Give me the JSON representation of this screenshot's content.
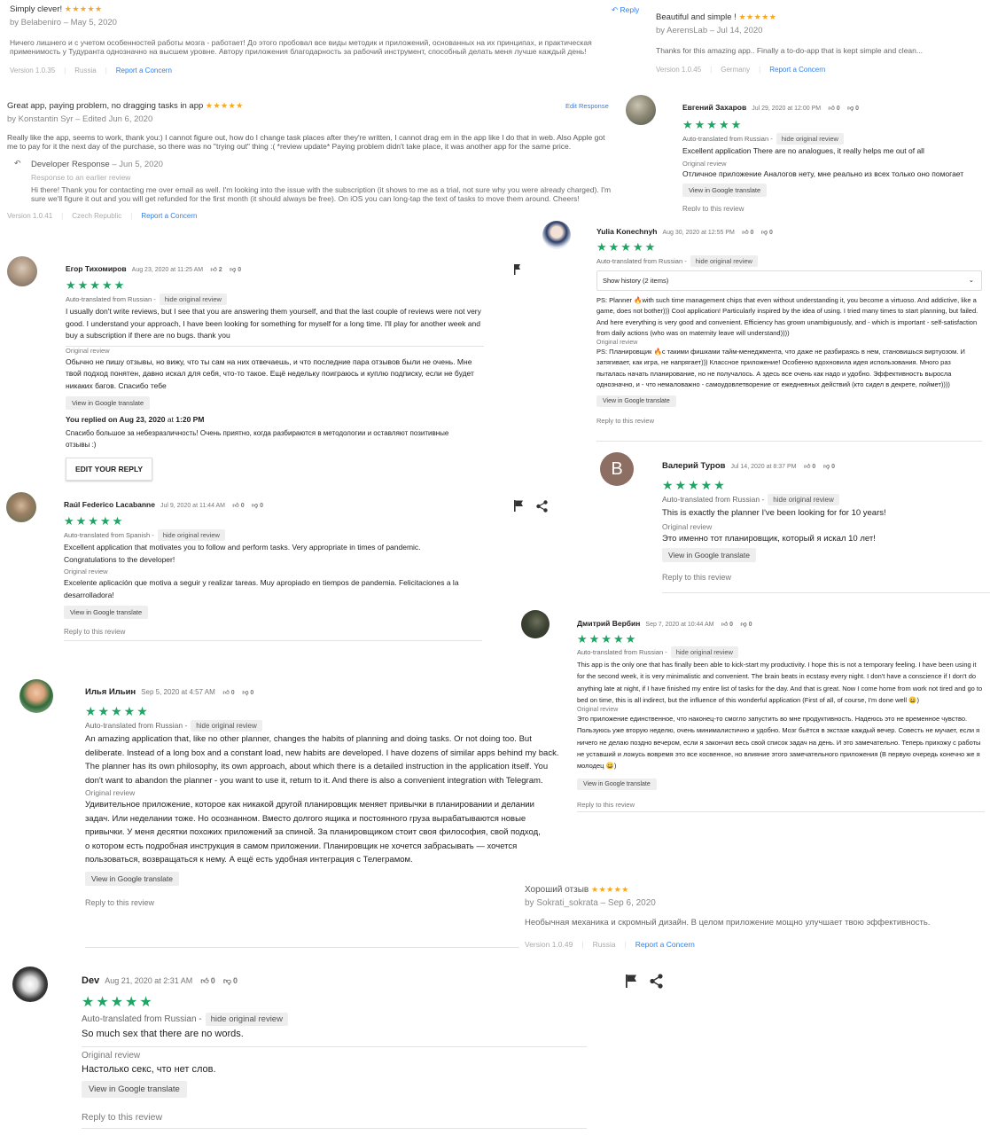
{
  "as1": {
    "title": "Simply clever!",
    "stars": "★★★★★",
    "author": "by Belabeniro – May 5, 2020",
    "body": "Ничего лишнего и с учетом особенностей работы мозга - работает! До этого пробовал все виды методик и приложений, основанных на их принципах, и практическая применимость у Тудуранта однозначно на высшем уровне. Автору приложения благодарность за рабочий инструмент, способный делать меня лучше каждый день!",
    "version": "Version 1.0.35",
    "country": "Russia",
    "report": "Report a Concern",
    "reply": "Reply"
  },
  "as2": {
    "title": "Beautiful and simple !",
    "stars": "★★★★★",
    "author": "by AerensLab – Jul 14, 2020",
    "body": "Thanks for this amazing app.. Finally a to-do-app that is kept simple and clean...",
    "version": "Version 1.0.45",
    "country": "Germany",
    "report": "Report a Concern"
  },
  "as3": {
    "title": "Great app, paying problem, no dragging tasks in app",
    "stars": "★★★★★",
    "author": "by Konstantin Syr – Edited Jun 6, 2020",
    "edit": "Edit Response",
    "body": "Really like the app, seems to work, thank you:) I cannot figure out, how do I change task places after they're written, I cannot drag em in the app like I do that in web. Also Apple got me to pay for it the next day of the purchase, so there was no \"trying out\" thing :( *review update* Paying problem didn't take place, it was another app for the same price.",
    "dev_title": "Developer Response",
    "dev_date": "– Jun 5, 2020",
    "dev_sub": "Response to an earlier review",
    "dev_body": "Hi there! Thank you for contacting me over email as well. I'm looking into the issue with the subscription (it shows to me as a trial, not sure why you were already charged). I'm sure we'll figure it out and you will get refunded for the first month (it should always be free). On iOS you can long-tap the text of tasks to move them around. Cheers!",
    "version": "Version 1.0.41",
    "country": "Czech Republic",
    "report": "Report a Concern"
  },
  "as4": {
    "title": "Хороший отзыв",
    "stars": "★★★★★",
    "author": "by Sokrati_sokrata – Sep 6, 2020",
    "body": "Необычная механика и скромный дизайн. В целом приложение мощно улучшает твою эффективность.",
    "version": "Version 1.0.49",
    "country": "Russia",
    "report": "Report a Concern"
  },
  "common": {
    "stars": "★★★★★",
    "hide": "hide original review",
    "original_label": "Original review",
    "view_translate": "View in Google translate",
    "reply_link": "Reply to this review",
    "zero": "0"
  },
  "gp_zakharov": {
    "name": "Евгений Захаров",
    "date": "Jul 29, 2020 at 12:00 PM",
    "auto": "Auto-translated from Russian -",
    "text": "Excellent application There are no analogues, it really helps me out of all",
    "original": "Отличное приложение Аналогов нету, мне реально из всех только оно помогает"
  },
  "gp_yulia": {
    "name": "Yulia Konechnyh",
    "date": "Aug 30, 2020 at 12:55 PM",
    "auto": "Auto-translated from Russian -",
    "history": "Show history (2 items)",
    "text": "PS: Planner 🔥with such time management chips that even without understanding it, you become a virtuoso. And addictive, like a game, does not bother))) Cool application! Particularly inspired by the idea of using. I tried many times to start planning, but failed. And here everything is very good and convenient. Efficiency has grown unambiguously, and - which is important - self-satisfaction from daily actions (who was on maternity leave will understand))))",
    "original": "PS: Планировщик 🔥с такими фишками тайм-менеджмента, что даже не разбираясь в нем, становишься виртуозом. И затягивает, как игра, не напрягает))) Классное приложение! Особенно вдохновила идея использования. Много раз пыталась начать планирование, но не получалось. А здесь все очень как надо и удобно. Эффективность выросла однозначно, и - что немаловажно - самоудовлетворение от ежедневных действий (кто сидел в декрете, поймет))))"
  },
  "gp_egor": {
    "name": "Егор Тихомиров",
    "date": "Aug 23, 2020 at 11:25 AM",
    "likes": "2",
    "auto": "Auto-translated from Russian -",
    "text": "I usually don't write reviews, but I see that you are answering them yourself, and that the last couple of reviews were not very good. I understand your approach, I have been looking for something for myself for a long time. I'll play for another week and buy a subscription if there are no bugs. thank you",
    "original": "Обычно не пишу отзывы, но вижу, что ты сам на них отвечаешь, и что последние пара отзывов были не очень. Мне твой подход понятен, давно искал для себя, что-то такое. Ещё недельку поиграюсь и куплю подписку, если не будет никаких багов. Спасибо тебе",
    "replied_prefix": "You replied on",
    "replied_date": "Aug 23, 2020",
    "replied_at": "at",
    "replied_time": "1:20 PM",
    "reply_text": "Спасибо большое за небезразличность! Очень приятно, когда разбираются в методологии и оставляют позитивные отзывы :)",
    "edit_button": "EDIT YOUR REPLY"
  },
  "gp_turov": {
    "avatar_letter": "B",
    "name": "Валерий Туров",
    "date": "Jul 14, 2020 at 8:37 PM",
    "auto": "Auto-translated from Russian -",
    "text": "This is exactly the planner I've been looking for for 10 years!",
    "original": "Это именно тот планировщик, который я искал 10 лет!"
  },
  "gp_raul": {
    "name": "Raúl Federico Lacabanne",
    "date": "Jul 9, 2020 at 11:44 AM",
    "auto": "Auto-translated from Spanish -",
    "text": "Excellent application that motivates you to follow and perform tasks. Very appropriate in times of pandemic. Congratulations to the developer!",
    "original": "Excelente aplicación que motiva a seguir y realizar tareas. Muy apropiado en tiempos de pandemia. Felicitaciones a la desarrolladora!"
  },
  "gp_verbin": {
    "name": "Дмитрий Вербин",
    "date": "Sep 7, 2020 at 10:44 AM",
    "auto": "Auto-translated from Russian -",
    "text": "This app is the only one that has finally been able to kick-start my productivity. I hope this is not a temporary feeling. I have been using it for the second week, it is very minimalistic and convenient. The brain beats in ecstasy every night. I don't have a conscience if I don't do anything late at night, if I have finished my entire list of tasks for the day. And that is great. Now I come home from work not tired and go to bed on time, this is all indirect, but the influence of this wonderful application (First of all, of course, I'm done well 😀)",
    "original": "Это приложение единственное, что наконец-то смогло запустить во мне продуктивность. Надеюсь это не временное чувство. Пользуюсь уже вторую неделю, очень минималистично и удобно. Мозг бьётся в экстазе каждый вечер. Совесть не мучает, если я ничего не делаю поздно вечером, если я закончил весь свой список задач на день. И это замечательно. Теперь прихожу с работы не уставший и ложусь вовремя это все косвенное, но влияние этого замечательного приложения (В первую очередь конечно же я молодец 😀)"
  },
  "gp_ilya": {
    "name": "Илья Ильин",
    "date": "Sep 5, 2020 at 4:57 AM",
    "auto": "Auto-translated from Russian -",
    "text": "An amazing application that, like no other planner, changes the habits of planning and doing tasks. Or not doing too. But deliberate. Instead of a long box and a constant load, new habits are developed. I have dozens of similar apps behind my back. The planner has its own philosophy, its own approach, about which there is a detailed instruction in the application itself. You don't want to abandon the planner - you want to use it, return to it. And there is also a convenient integration with Telegram.",
    "original": "Удивительное приложение, которое как никакой другой планировщик меняет привычки в планировании и делании задач. Или неделании тоже. Но осознанном. Вместо долгого ящика и постоянного груза вырабатываются новые привычки. У меня десятки похожих приложений за спиной. За планировщиком стоит своя философия, свой подход, о котором есть подробная инструкция в самом приложении. Планировщик не хочется забрасывать — хочется пользоваться, возвращаться к нему. А ещё есть удобная интеграция с Телеграмом."
  },
  "gp_dev": {
    "name": "Dev",
    "date": "Aug 21, 2020 at 2:31 AM",
    "auto": "Auto-translated from Russian -",
    "text": "So much sex that there are no words.",
    "original": "Настолько секс, что нет слов."
  }
}
